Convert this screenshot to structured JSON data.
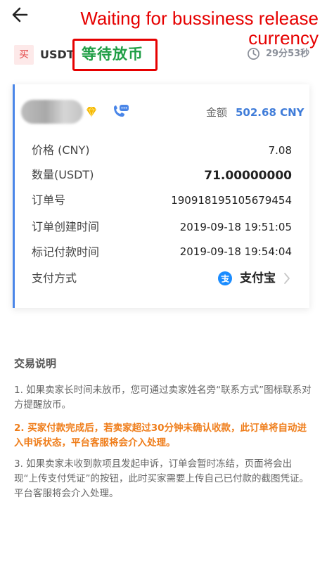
{
  "annotation": {
    "line1": "Waiting for bussiness release",
    "line2": "currency"
  },
  "header": {
    "trade_type": "买",
    "coin": "USDT",
    "status": "等待放币",
    "countdown": "29分53秒"
  },
  "order": {
    "amount_label": "金额",
    "amount_value": "502.68 CNY",
    "rows": [
      {
        "label": "价格 (CNY)",
        "value": "7.08"
      },
      {
        "label": "数量(USDT)",
        "value": "71.00000000"
      },
      {
        "label": "订单号",
        "value": "190918195105679454"
      },
      {
        "label": "订单创建时间",
        "value": "2019-09-18 19:51:05"
      },
      {
        "label": "标记付款时间",
        "value": "2019-09-18 19:54:04"
      },
      {
        "label": "支付方式",
        "value": "支付宝"
      }
    ]
  },
  "notes": {
    "title": "交易说明",
    "items": [
      "1. 如果卖家长时间未放币，您可通过卖家姓名旁“联系方式”图标联系对方提醒放币。",
      "2. 买家付款完成后，若卖家超过30分钟未确认收款，此订单将自动进入申诉状态，平台客服将会介入处理。",
      "3. 如果卖家未收到款项且发起申诉，订单会暂时冻结，页面将会出现“上传支付凭证”的按钮，此时买家需要上传自己已付款的截图凭证。平台客服将会介入处理。"
    ]
  },
  "icons": {
    "back": "arrow-left-icon",
    "clock": "clock-icon",
    "diamond": "diamond-icon",
    "contact": "phone-chat-icon",
    "alipay": "alipay-icon",
    "chevron": "chevron-right-icon"
  },
  "colors": {
    "status_green": "#1f9e45",
    "annotation_red": "#e60000",
    "accent_blue": "#3f7cd9",
    "warning_orange": "#ef7d1a"
  }
}
